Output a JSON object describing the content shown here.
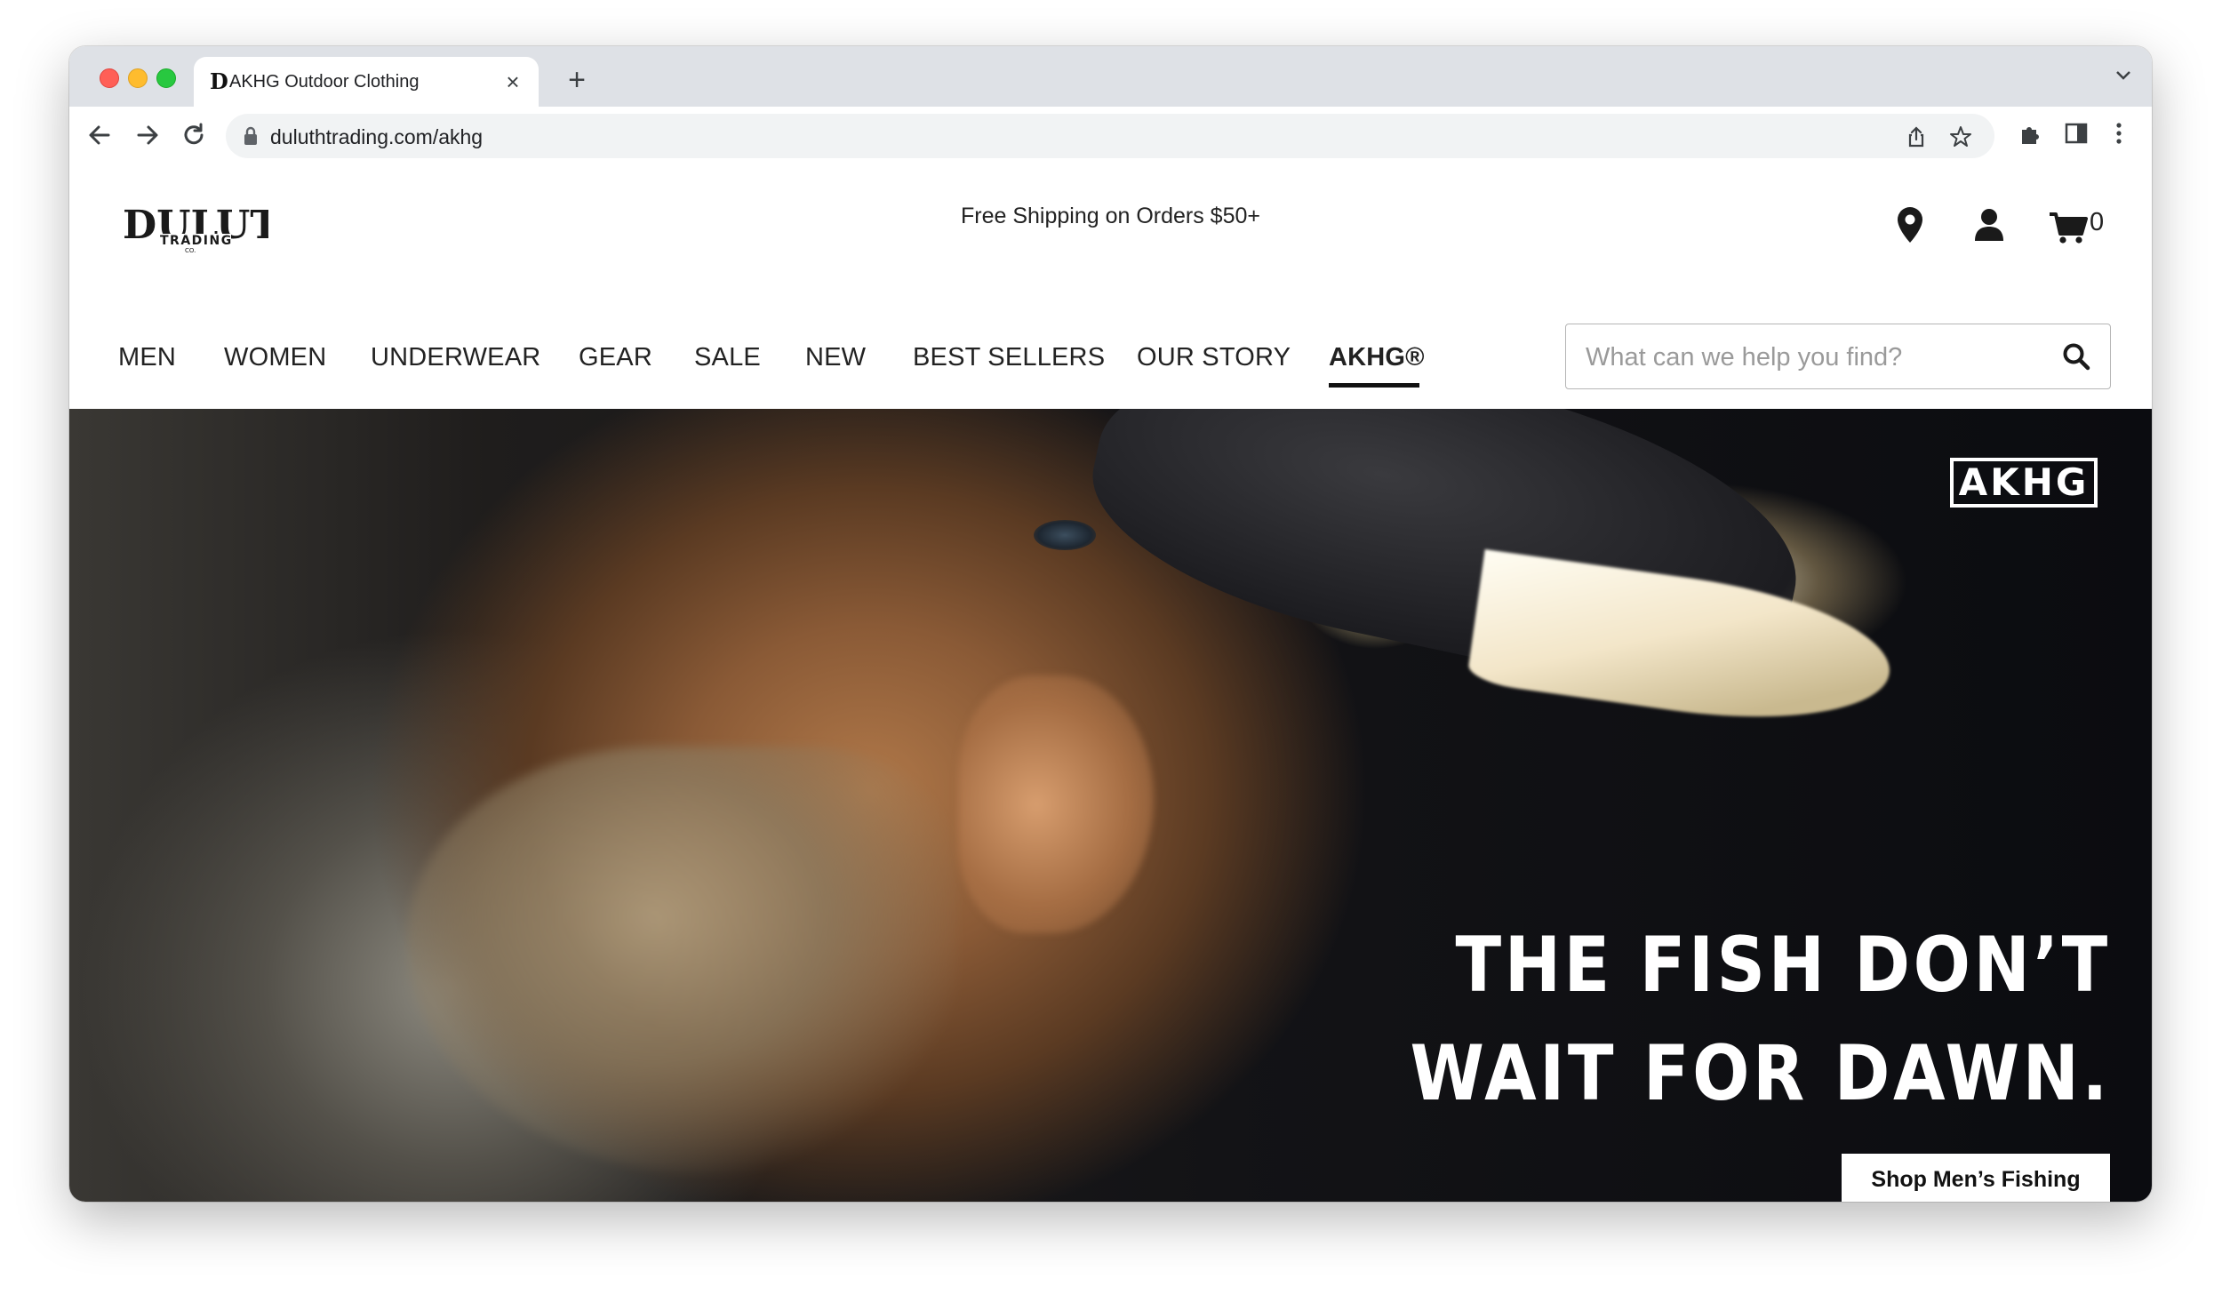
{
  "browser": {
    "tab": {
      "title": "AKHG Outdoor Clothing",
      "favicon_text": "D"
    },
    "address_bar": {
      "url": "duluthtrading.com/akhg"
    }
  },
  "header": {
    "logo": {
      "line1": "DULUTH",
      "line2": "TRADING",
      "line3": "CO."
    },
    "promo": "Free Shipping on Orders $50+",
    "cart_count": "0"
  },
  "nav": {
    "items": [
      {
        "label": "MEN"
      },
      {
        "label": "WOMEN"
      },
      {
        "label": "UNDERWEAR"
      },
      {
        "label": "GEAR"
      },
      {
        "label": "SALE"
      },
      {
        "label": "NEW"
      },
      {
        "label": "BEST SELLERS"
      },
      {
        "label": "OUR STORY"
      },
      {
        "label": "AKHG®"
      }
    ],
    "active": "AKHG®"
  },
  "search": {
    "placeholder": "What can we help you find?"
  },
  "hero": {
    "brand_badge": "AKHG",
    "headline_line1": "THE FISH DON’T",
    "headline_line2": "WAIT FOR DAWN.",
    "cta_label": "Shop Men’s Fishing"
  },
  "colors": {
    "tabstrip_bg": "#dee1e6",
    "omnibox_bg": "#f1f3f4",
    "text_dark": "#222222",
    "hero_bg": "#131316",
    "cta_bg": "#ffffff"
  },
  "icons": [
    "back-arrow-icon",
    "forward-arrow-icon",
    "reload-icon",
    "lock-icon",
    "share-icon",
    "bookmark-star-icon",
    "extensions-icon",
    "side-panel-icon",
    "more-menu-icon",
    "location-pin-icon",
    "account-icon",
    "cart-icon",
    "search-icon"
  ]
}
